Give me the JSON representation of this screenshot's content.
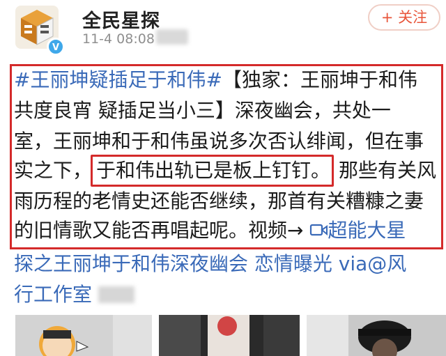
{
  "account": {
    "name": "全民星探",
    "timestamp": "11-4 08:08",
    "follow_label": "+ 关注"
  },
  "post": {
    "hashtag": "#王丽坤疑插足于和伟#",
    "l1_rest": "【独家：王丽坤于和伟",
    "l2": "共度良宵 疑插足当小三】深夜幽会，共处一",
    "l3": "室，王丽坤和于和伟虽说多次否认绯闻，但在事",
    "l4_start": "实之下，",
    "l4_highlight": "于和伟出轨已是板上钉钉。",
    "l4_end": "那些有关风",
    "l5": "雨历程的老情史还能否继续，那首有关糟糠之妻",
    "l6_text": "的旧情歌又能否再唱起呢。视频→ ",
    "l6_link": "超能大星",
    "after1": "探之王丽坤于和伟深夜幽会 恋情曝光 via@风",
    "after2": "行工作室"
  },
  "colors": {
    "link": "#3a6ab8",
    "highlight_border": "#d42a2a",
    "follow": "#e8553a"
  },
  "icons": {
    "verified": "verified-badge-icon",
    "video": "video-icon"
  }
}
